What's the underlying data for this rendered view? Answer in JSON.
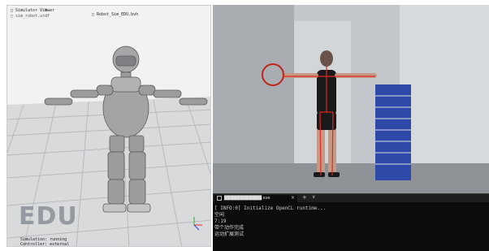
{
  "simulator": {
    "title": "□ Simulator Viewer",
    "subtitle": "□ sim_robot.urdf",
    "file_label": "□ Robot_Sim_EDU.bvh",
    "close_glyph": "×",
    "logo_text": "EDU",
    "info_line_1": "Simulation: running",
    "info_line_2": "Controller: external",
    "colors": {
      "floor_light": "#d9dadc",
      "floor_dark": "#bfc1c4",
      "robot": "#9a9a9a",
      "sky": "#f0f2f4"
    }
  },
  "camera": {
    "colors": {
      "skeleton": "#e0291f",
      "marker_ring": "#c0231a",
      "wall": "#c8ccd0"
    }
  },
  "terminal": {
    "tab_label": "████████████.exe",
    "close_glyph": "×",
    "new_tab_glyph": "+",
    "dropdown_glyph": "∨",
    "lines": [
      "[ INFO:0] Initialize OpenCL runtime...",
      "空闲",
      "7:19",
      "带个动作完成",
      "运动扩展测试"
    ]
  }
}
